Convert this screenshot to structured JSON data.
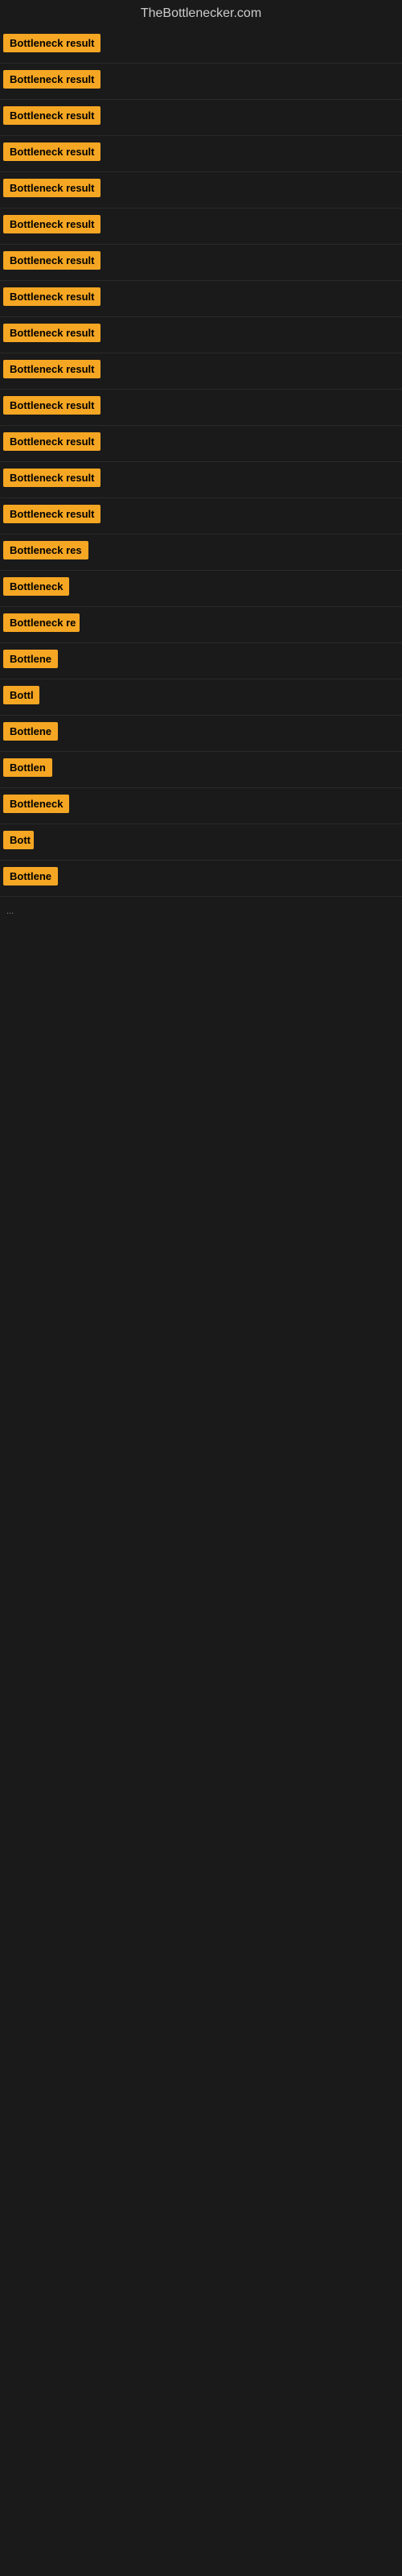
{
  "site": {
    "title": "TheBottlenecker.com"
  },
  "results": [
    {
      "id": 1,
      "label": "Bottleneck result",
      "width": 130
    },
    {
      "id": 2,
      "label": "Bottleneck result",
      "width": 130
    },
    {
      "id": 3,
      "label": "Bottleneck result",
      "width": 130
    },
    {
      "id": 4,
      "label": "Bottleneck result",
      "width": 130
    },
    {
      "id": 5,
      "label": "Bottleneck result",
      "width": 130
    },
    {
      "id": 6,
      "label": "Bottleneck result",
      "width": 130
    },
    {
      "id": 7,
      "label": "Bottleneck result",
      "width": 130
    },
    {
      "id": 8,
      "label": "Bottleneck result",
      "width": 130
    },
    {
      "id": 9,
      "label": "Bottleneck result",
      "width": 130
    },
    {
      "id": 10,
      "label": "Bottleneck result",
      "width": 130
    },
    {
      "id": 11,
      "label": "Bottleneck result",
      "width": 130
    },
    {
      "id": 12,
      "label": "Bottleneck result",
      "width": 130
    },
    {
      "id": 13,
      "label": "Bottleneck result",
      "width": 130
    },
    {
      "id": 14,
      "label": "Bottleneck result",
      "width": 130
    },
    {
      "id": 15,
      "label": "Bottleneck res",
      "width": 110
    },
    {
      "id": 16,
      "label": "Bottleneck",
      "width": 82
    },
    {
      "id": 17,
      "label": "Bottleneck re",
      "width": 95
    },
    {
      "id": 18,
      "label": "Bottlene",
      "width": 72
    },
    {
      "id": 19,
      "label": "Bottl",
      "width": 45
    },
    {
      "id": 20,
      "label": "Bottlene",
      "width": 72
    },
    {
      "id": 21,
      "label": "Bottlen",
      "width": 62
    },
    {
      "id": 22,
      "label": "Bottleneck",
      "width": 82
    },
    {
      "id": 23,
      "label": "Bott",
      "width": 38
    },
    {
      "id": 24,
      "label": "Bottlene",
      "width": 72
    }
  ],
  "ellipsis": "..."
}
